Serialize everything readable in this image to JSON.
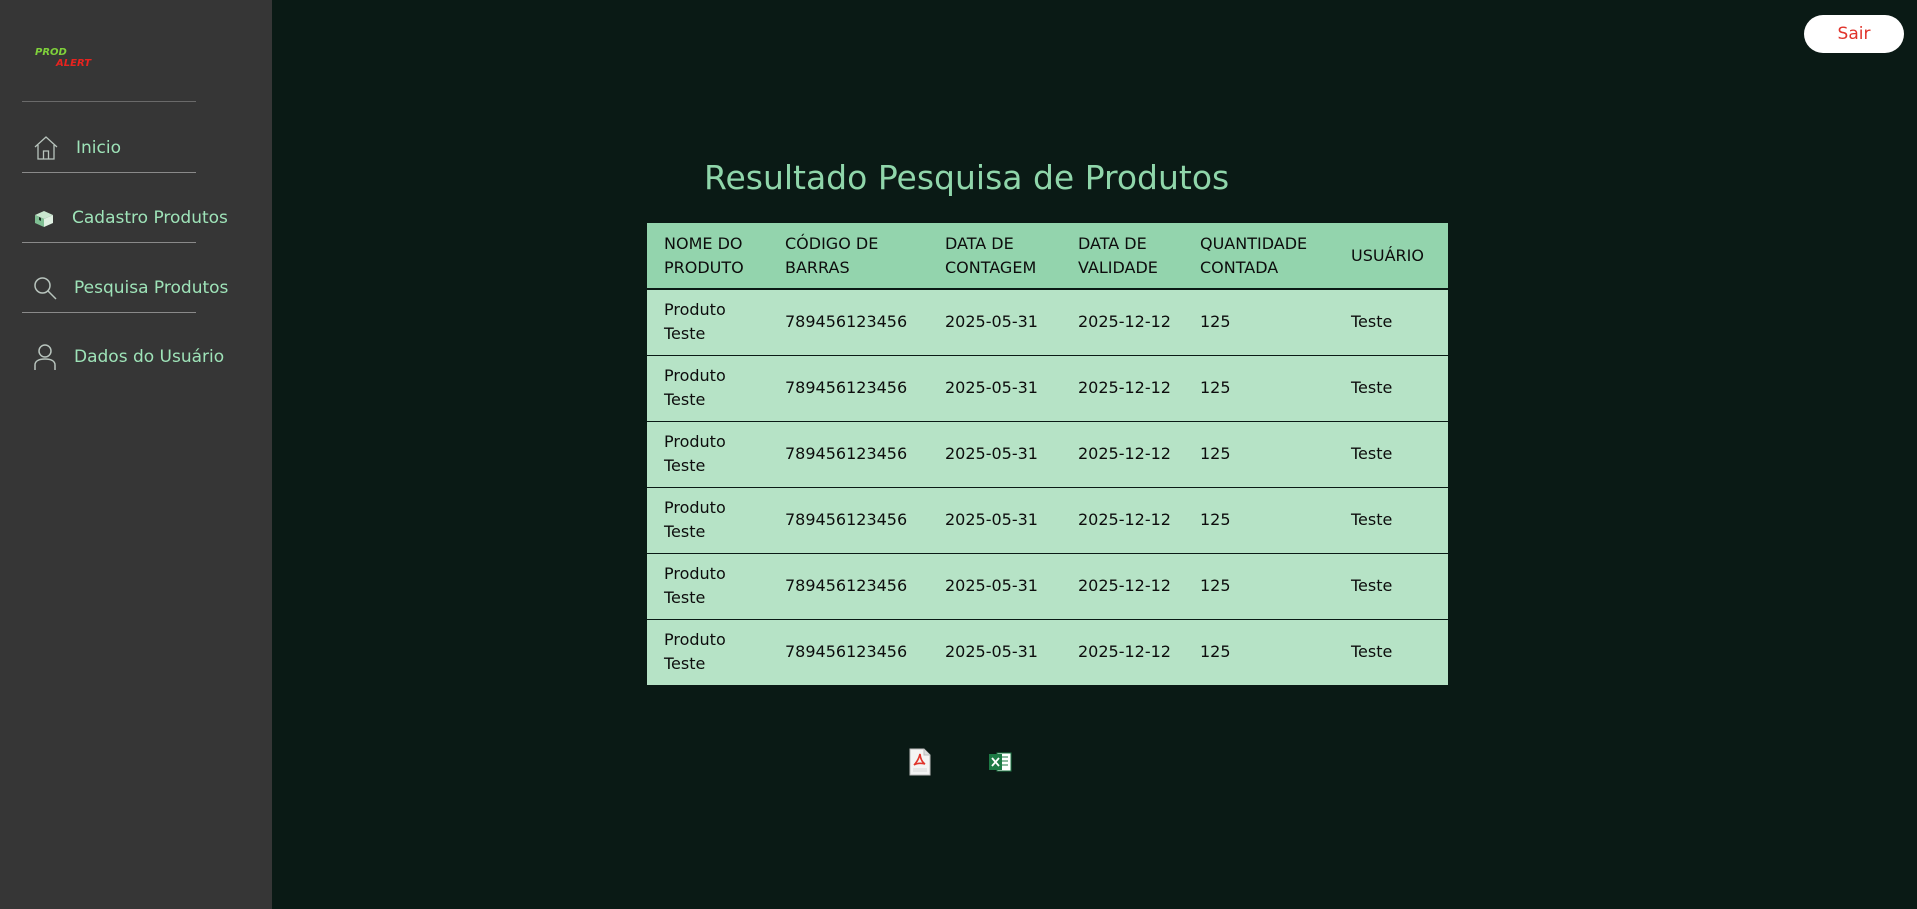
{
  "app": {
    "logo_text_line1": "PROD",
    "logo_text_line2": "ALERT"
  },
  "sidebar": {
    "items": [
      {
        "label": "Inicio",
        "icon": "home-icon"
      },
      {
        "label": "Cadastro Produtos",
        "icon": "box-icon"
      },
      {
        "label": "Pesquisa Produtos",
        "icon": "search-icon"
      },
      {
        "label": "Dados do Usuário",
        "icon": "user-icon"
      }
    ]
  },
  "header": {
    "logout_label": "Sair"
  },
  "main": {
    "title": "Resultado Pesquisa de Produtos",
    "table": {
      "columns": [
        "NOME DO PRODUTO",
        "CÓDIGO DE BARRAS",
        "DATA DE CONTAGEM",
        "DATA DE VALIDADE",
        "QUANTIDADE CONTADA",
        "USUÁRIO"
      ],
      "rows": [
        [
          "Produto Teste",
          "789456123456",
          "2025-05-31",
          "2025-12-12",
          "125",
          "Teste"
        ],
        [
          "Produto Teste",
          "789456123456",
          "2025-05-31",
          "2025-12-12",
          "125",
          "Teste"
        ],
        [
          "Produto Teste",
          "789456123456",
          "2025-05-31",
          "2025-12-12",
          "125",
          "Teste"
        ],
        [
          "Produto Teste",
          "789456123456",
          "2025-05-31",
          "2025-12-12",
          "125",
          "Teste"
        ],
        [
          "Produto Teste",
          "789456123456",
          "2025-05-31",
          "2025-12-12",
          "125",
          "Teste"
        ],
        [
          "Produto Teste",
          "789456123456",
          "2025-05-31",
          "2025-12-12",
          "125",
          "Teste"
        ]
      ]
    },
    "exports": [
      {
        "icon": "pdf-icon"
      },
      {
        "icon": "excel-icon"
      }
    ]
  },
  "colors": {
    "background": "#0a1a15",
    "sidebar": "#363636",
    "accent_text": "#9ee3b8",
    "table_header": "#93d4ad",
    "table_row": "#b6e3c6",
    "logout_text": "#e0332b"
  }
}
